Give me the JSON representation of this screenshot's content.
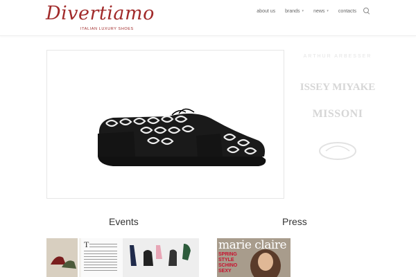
{
  "header": {
    "logo_text": "Divertiamo",
    "logo_tagline": "ITALIAN LUXURY SHOES",
    "nav": [
      {
        "label": "about us",
        "has_dropdown": false
      },
      {
        "label": "brands",
        "has_dropdown": true
      },
      {
        "label": "news",
        "has_dropdown": true
      },
      {
        "label": "contacts",
        "has_dropdown": false
      }
    ]
  },
  "sidebar": {
    "brands": [
      "ARTHUR ARBESSER",
      "ISSEY MIYAKE",
      "MISSONI"
    ]
  },
  "sections": {
    "events_title": "Events",
    "press_title": "Press"
  },
  "press_thumb": {
    "magazine": "marie claire",
    "cover_lines": [
      "SPRING",
      "STYLE",
      "SCHINO",
      "SEXY"
    ]
  },
  "colors": {
    "brand": "#a12a2a",
    "nav_text": "#666666"
  }
}
